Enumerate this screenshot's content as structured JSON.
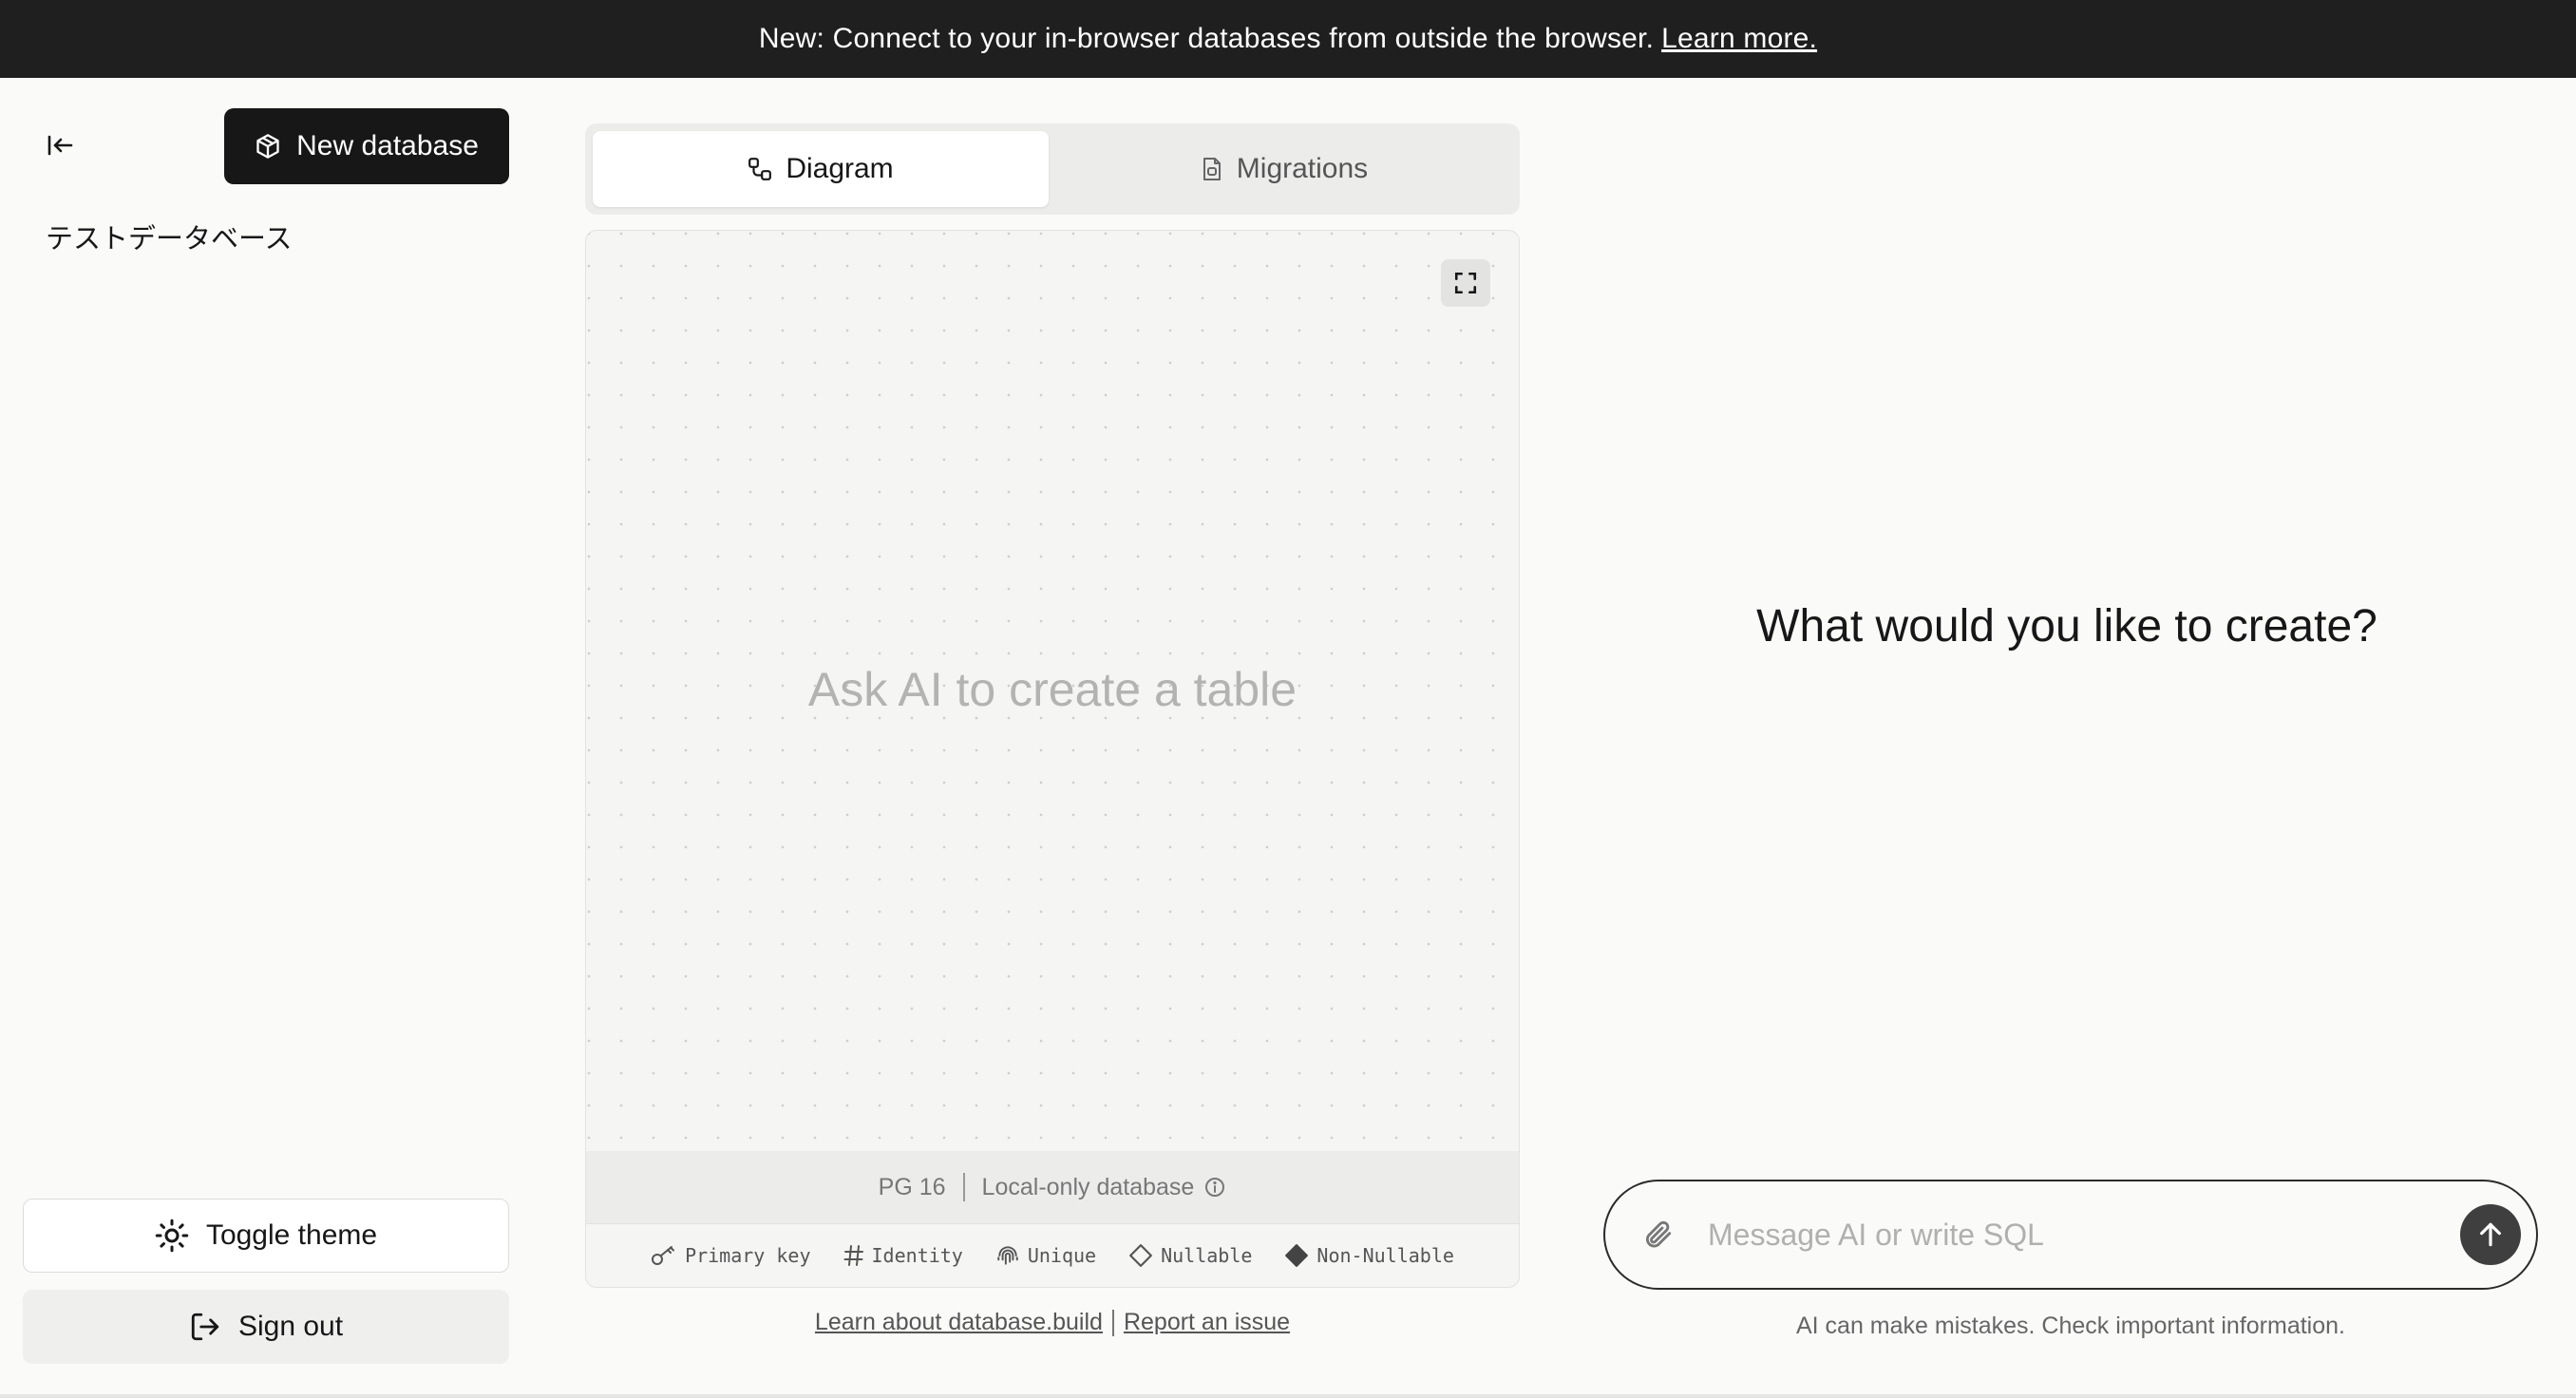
{
  "banner": {
    "text": "New: Connect to your in-browser databases from outside the browser.",
    "link": "Learn more."
  },
  "sidebar": {
    "new_database_label": "New database",
    "databases": [
      "テストデータベース"
    ],
    "toggle_theme_label": "Toggle theme",
    "sign_out_label": "Sign out"
  },
  "tabs": [
    {
      "label": "Diagram",
      "icon": "diagram-icon",
      "active": true
    },
    {
      "label": "Migrations",
      "icon": "file-icon",
      "active": false
    }
  ],
  "diagram": {
    "empty_message": "Ask AI to create a table",
    "version": "PG 16",
    "mode": "Local-only database",
    "legend": [
      "Primary key",
      "Identity",
      "Unique",
      "Nullable",
      "Non-Nullable"
    ]
  },
  "footer": {
    "learn_link": "Learn about database.build",
    "report_link": "Report an issue"
  },
  "chat": {
    "title": "What would you like to create?",
    "placeholder": "Message AI or write SQL",
    "disclaimer": "AI can make mistakes. Check important information."
  },
  "colors": {
    "banner_bg": "#1f1f1f",
    "primary_button_bg": "#171717",
    "page_bg": "#fafaf9"
  }
}
